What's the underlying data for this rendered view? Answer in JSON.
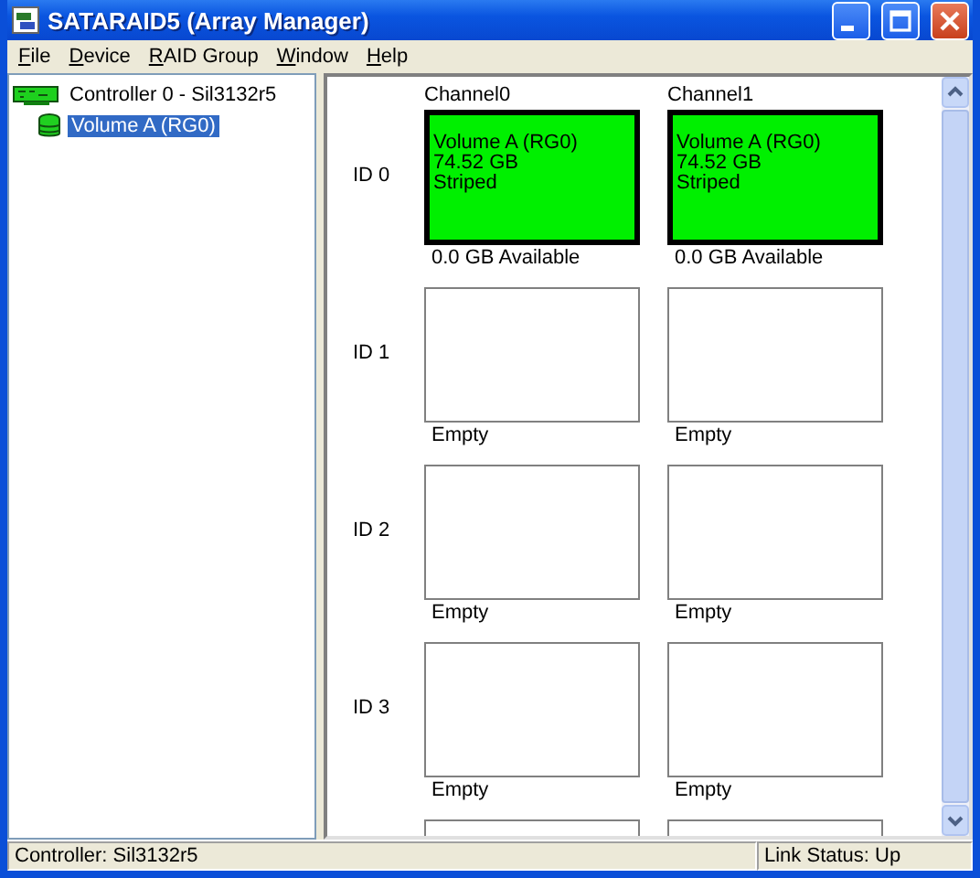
{
  "window": {
    "title": "SATARAID5 (Array Manager)"
  },
  "menu": [
    "File",
    "Device",
    "RAID Group",
    "Window",
    "Help"
  ],
  "tree": [
    {
      "label": "Controller 0 - Sil3132r5",
      "kind": "controller",
      "selected": false,
      "children": [
        {
          "label": "Volume A (RG0)",
          "kind": "volume",
          "selected": true
        }
      ]
    }
  ],
  "grid": {
    "channels": [
      "Channel0",
      "Channel1"
    ],
    "rows": [
      {
        "id": "ID 0",
        "cells": [
          {
            "kind": "volume",
            "lines": [
              "Volume A (RG0)",
              "74.52 GB",
              "Striped"
            ],
            "caption": "0.0 GB Available"
          },
          {
            "kind": "volume",
            "lines": [
              "Volume A (RG0)",
              "74.52 GB",
              "Striped"
            ],
            "caption": "0.0 GB Available"
          }
        ]
      },
      {
        "id": "ID 1",
        "cells": [
          {
            "kind": "empty",
            "caption": "Empty"
          },
          {
            "kind": "empty",
            "caption": "Empty"
          }
        ]
      },
      {
        "id": "ID 2",
        "cells": [
          {
            "kind": "empty",
            "caption": "Empty"
          },
          {
            "kind": "empty",
            "caption": "Empty"
          }
        ]
      },
      {
        "id": "ID 3",
        "cells": [
          {
            "kind": "empty",
            "caption": "Empty"
          },
          {
            "kind": "empty",
            "caption": "Empty"
          }
        ]
      },
      {
        "cells": [
          {
            "kind": "empty"
          },
          {
            "kind": "empty"
          }
        ]
      }
    ]
  },
  "status_bar": {
    "left": "Controller: Sil3132r5",
    "right": "Link Status: Up"
  }
}
